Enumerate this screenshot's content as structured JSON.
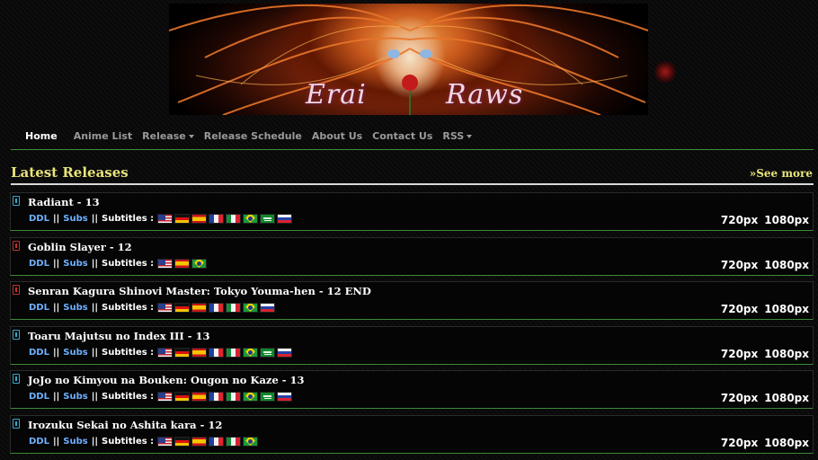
{
  "banner": {
    "text_left": "Erai",
    "text_right": "Raws"
  },
  "nav": {
    "items": [
      {
        "label": "Home",
        "active": true,
        "dropdown": false
      },
      {
        "label": "Anime List",
        "active": false,
        "dropdown": false
      },
      {
        "label": "Release",
        "active": false,
        "dropdown": true
      },
      {
        "label": "Release Schedule",
        "active": false,
        "dropdown": false
      },
      {
        "label": "About Us",
        "active": false,
        "dropdown": false
      },
      {
        "label": "Contact Us",
        "active": false,
        "dropdown": false
      },
      {
        "label": "RSS",
        "active": false,
        "dropdown": true
      }
    ]
  },
  "section": {
    "title": "Latest Releases",
    "see_more": "»See more"
  },
  "release_labels": {
    "ddl": "DDL",
    "subs": "Subs",
    "sep": "||",
    "subtitles": "Subtitles :",
    "res_720": "720px",
    "res_1080": "1080px"
  },
  "releases": [
    {
      "title": "Radiant - 13",
      "icon_color": "blue",
      "flags": [
        "us",
        "de",
        "es",
        "fr",
        "it",
        "br",
        "sa",
        "ru"
      ]
    },
    {
      "title": "Goblin Slayer - 12",
      "icon_color": "red",
      "flags": [
        "us",
        "es",
        "br"
      ]
    },
    {
      "title": "Senran Kagura Shinovi Master: Tokyo Youma-hen - 12 END",
      "icon_color": "red",
      "flags": [
        "us",
        "de",
        "es",
        "fr",
        "it",
        "br",
        "ru"
      ]
    },
    {
      "title": "Toaru Majutsu no Index III - 13",
      "icon_color": "blue",
      "flags": [
        "us",
        "de",
        "es",
        "fr",
        "it",
        "br",
        "sa",
        "ru"
      ]
    },
    {
      "title": "JoJo no Kimyou na Bouken: Ougon no Kaze - 13",
      "icon_color": "blue",
      "flags": [
        "us",
        "de",
        "es",
        "fr",
        "it",
        "br",
        "sa",
        "ru"
      ]
    },
    {
      "title": "Irozuku Sekai no Ashita kara - 12",
      "icon_color": "blue",
      "flags": [
        "us",
        "de",
        "es",
        "fr",
        "it",
        "br"
      ]
    }
  ],
  "colors": {
    "accent_yellow": "#e8e37a",
    "link_blue": "#6fb0ff",
    "divider_green": "#3f8f3a"
  }
}
